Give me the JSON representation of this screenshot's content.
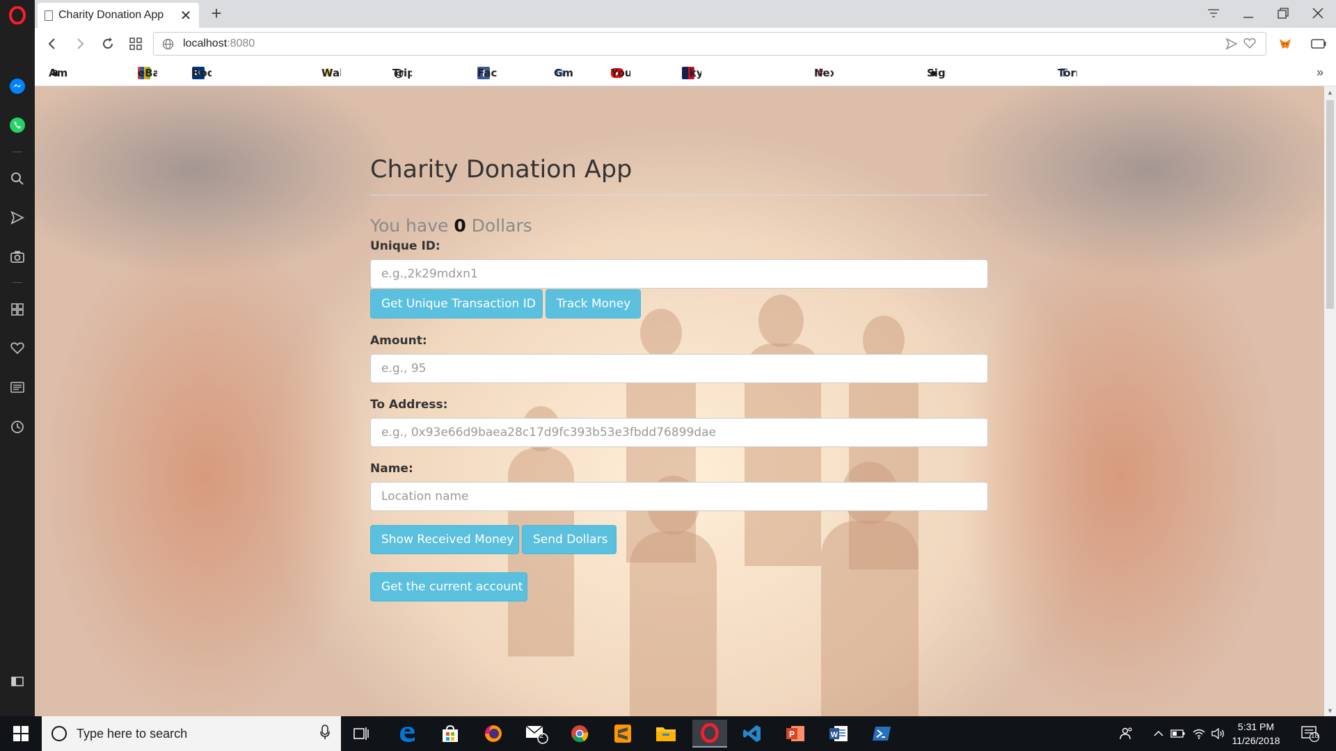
{
  "browser": {
    "tab_title": "Charity Donation App",
    "tab_close": "✕",
    "new_tab": "+",
    "url_host": "localhost",
    "url_port": ":8080",
    "more_bookmarks": "»"
  },
  "bookmarks": [
    {
      "label": "Amazon.com",
      "icon": "amazon-icon",
      "glyph": "a",
      "color": "#000000"
    },
    {
      "label": "eBay",
      "icon": "ebay-icon",
      "glyph": "",
      "color": "#e53238"
    },
    {
      "label": "Booking.com: Cheap",
      "icon": "booking-icon",
      "glyph": "B.",
      "color": "#003580"
    },
    {
      "label": "Walmart",
      "icon": "walmart-icon",
      "glyph": "✳",
      "color": "#ffc220"
    },
    {
      "label": "TripAdvisor",
      "icon": "tripadvisor-icon",
      "glyph": "◎",
      "color": "#333333"
    },
    {
      "label": "Facebook",
      "icon": "facebook-icon",
      "glyph": "f",
      "color": "#3b5998"
    },
    {
      "label": "Gmail",
      "icon": "google-icon",
      "glyph": "G",
      "color": "#4285f4"
    },
    {
      "label": "YouTube",
      "icon": "youtube-icon",
      "glyph": "▶",
      "color": "#ff0000"
    },
    {
      "label": "Sky Sports - Sports N",
      "icon": "skysports-icon",
      "glyph": "",
      "color": "#c8102e"
    },
    {
      "label": "Next Coders Slack",
      "icon": "slack-icon",
      "glyph": "#",
      "color": "#4a154b"
    },
    {
      "label": "Sign in to GitHub · Gi",
      "icon": "github-icon",
      "glyph": "●",
      "color": "#111111"
    },
    {
      "label": "Torrent Search torren",
      "icon": "torrent-icon",
      "glyph": "T",
      "color": "#2f6db5"
    }
  ],
  "app": {
    "title": "Charity Donation App",
    "balance_prefix": "You have ",
    "balance_value": "0",
    "balance_suffix": " Dollars",
    "unique_id_label": "Unique ID:",
    "unique_id_placeholder": "e.g.,2k29mdxn1",
    "get_id_button": "Get Unique Transaction ID",
    "track_button": "Track Money",
    "amount_label": "Amount:",
    "amount_placeholder": "e.g., 95",
    "address_label": "To Address:",
    "address_placeholder": "e.g., 0x93e66d9baea28c17d9fc393b53e3fbdd76899dae",
    "name_label": "Name:",
    "name_placeholder": "Location name",
    "show_received_button": "Show Received Money",
    "send_button": "Send Dollars",
    "current_account_button": "Get the current account"
  },
  "taskbar": {
    "search_placeholder": "Type here to search",
    "mail_badge": "2",
    "time": "5:31 PM",
    "date": "11/26/2018",
    "notification_count": "18"
  },
  "colors": {
    "accent_button": "#5bc0de",
    "opera_red": "#ff1b2d"
  }
}
